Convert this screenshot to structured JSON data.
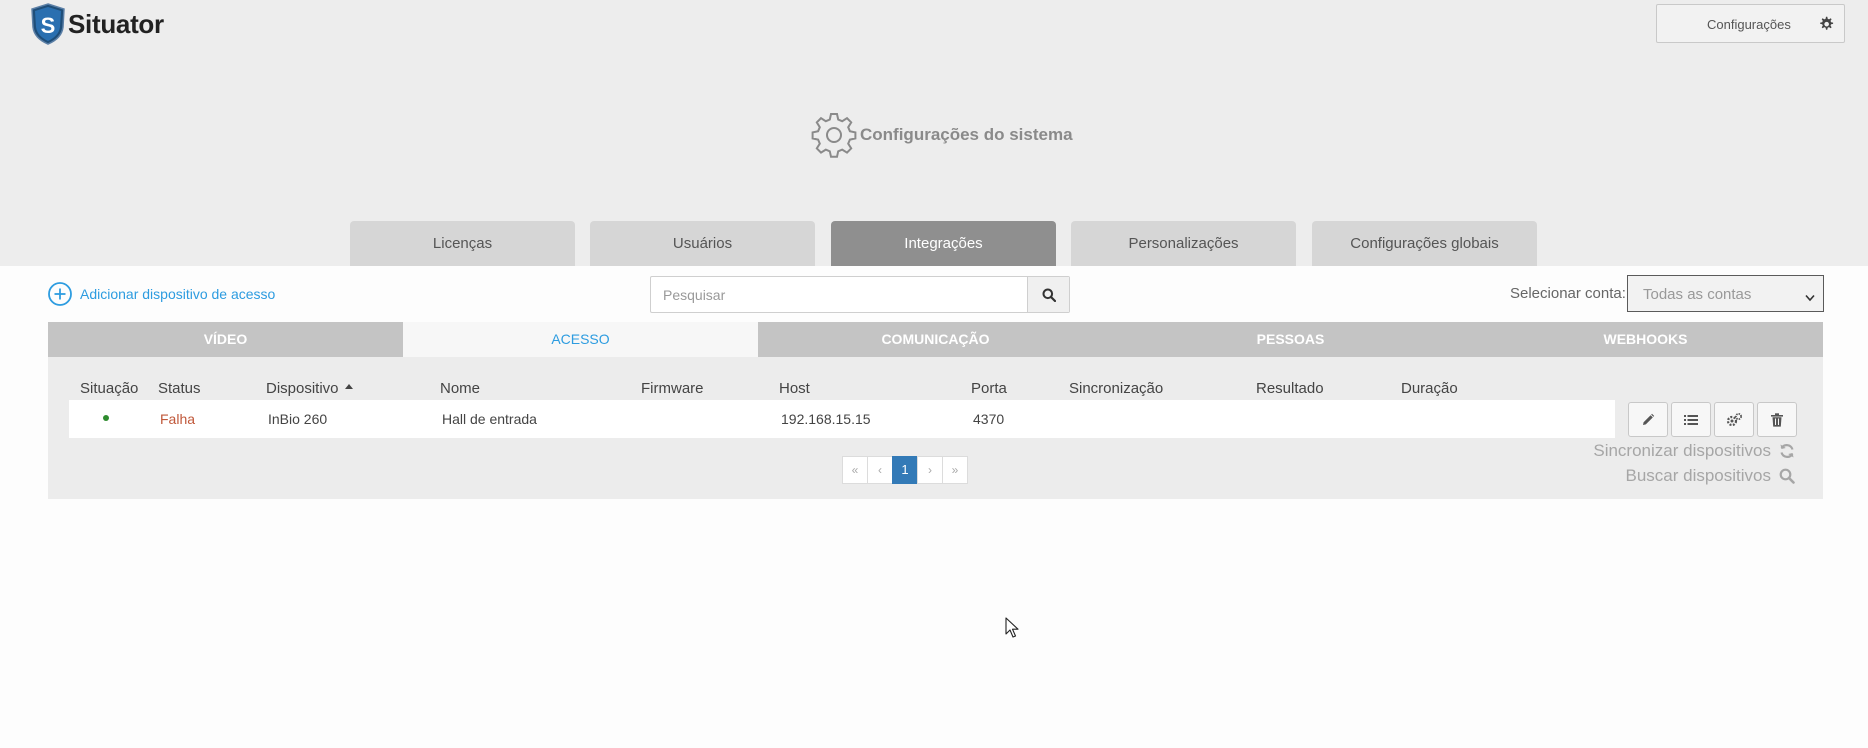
{
  "header": {
    "brand": "Situator",
    "settings_button": "Configurações",
    "page_title": "Configurações do sistema"
  },
  "main_tabs": [
    {
      "label": "Licenças",
      "active": false
    },
    {
      "label": "Usuários",
      "active": false
    },
    {
      "label": "Integrações",
      "active": true
    },
    {
      "label": "Personalizações",
      "active": false
    },
    {
      "label": "Configurações globais",
      "active": false
    }
  ],
  "toolbar": {
    "add_device": "Adicionar dispositivo de acesso",
    "search_placeholder": "Pesquisar",
    "account_label": "Selecionar conta:",
    "account_value": "Todas as contas"
  },
  "sub_tabs": [
    {
      "label": "Vídeo",
      "active": false
    },
    {
      "label": "Acesso",
      "active": true
    },
    {
      "label": "Comunicação",
      "active": false
    },
    {
      "label": "Pessoas",
      "active": false
    },
    {
      "label": "Webhooks",
      "active": false
    }
  ],
  "table": {
    "columns": [
      "Situação",
      "Status",
      "Dispositivo",
      "Nome",
      "Firmware",
      "Host",
      "Porta",
      "Sincronização",
      "Resultado",
      "Duração"
    ],
    "sorted_column": "Dispositivo",
    "sort_direction": "ascending",
    "rows": [
      {
        "situacao": "online-dot",
        "status": "Falha",
        "dispositivo": "InBio 260",
        "nome": "Hall de entrada",
        "firmware": "",
        "host": "192.168.15.15",
        "porta": "4370",
        "sincronizacao": "",
        "resultado": "",
        "duracao": ""
      }
    ],
    "row_actions": [
      "pencil-icon",
      "list-icon",
      "cogs-icon",
      "trash-icon"
    ]
  },
  "pagination": {
    "first": "«",
    "prev": "‹",
    "current": "1",
    "next": "›",
    "last": "»"
  },
  "actions": {
    "sync_devices": "Sincronizar dispositivos",
    "find_devices": "Buscar dispositivos"
  },
  "colors": {
    "accent": "#2d9ce0",
    "status_fail": "#c0583a",
    "online": "#2e8b2e",
    "active_page": "#337ab7"
  }
}
